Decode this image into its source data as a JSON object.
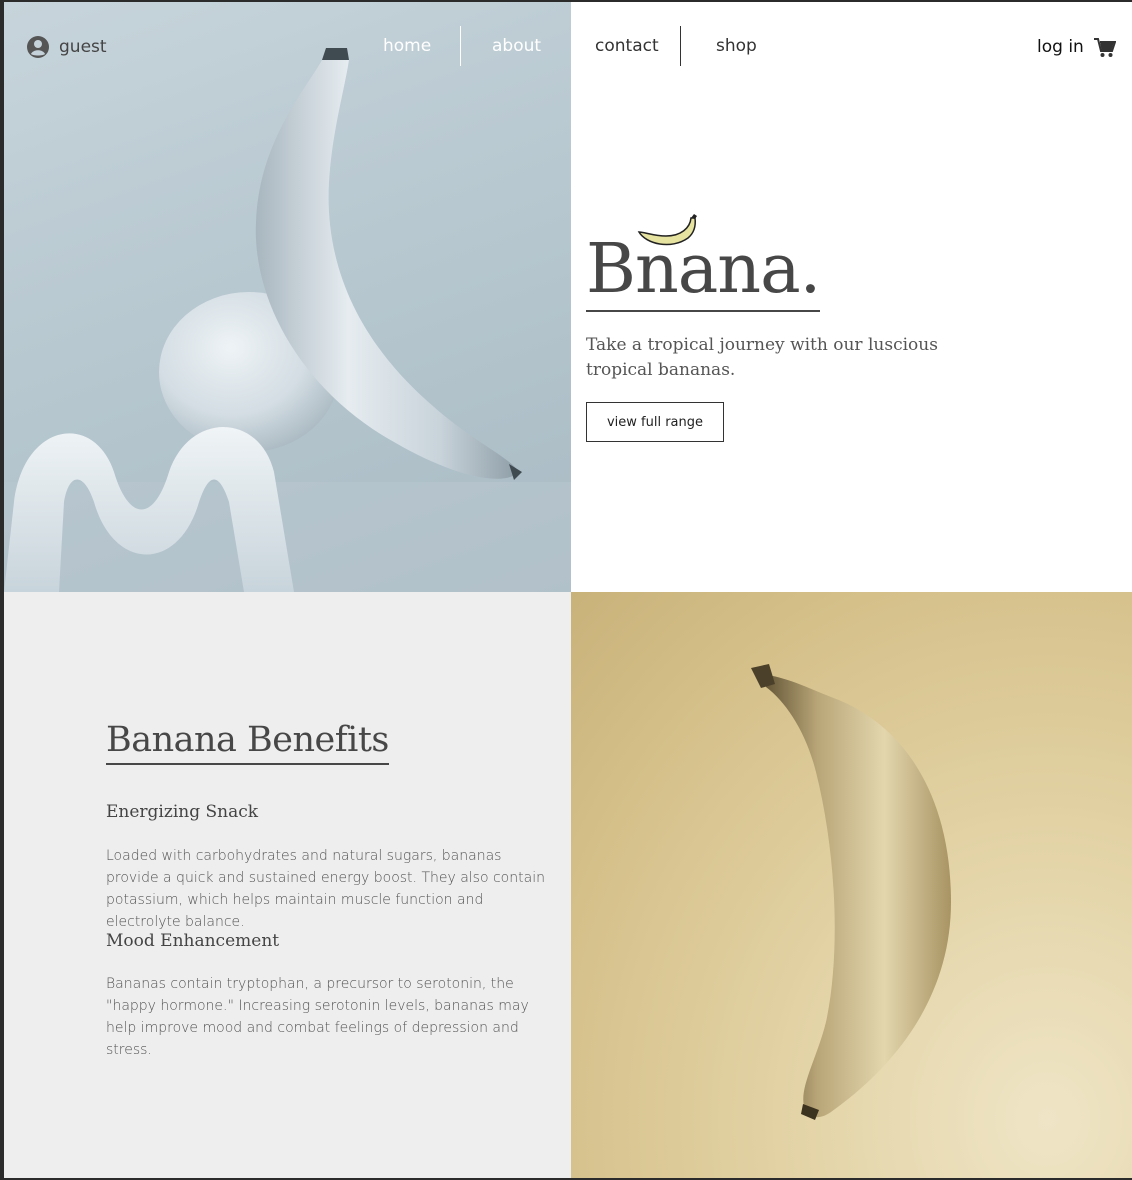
{
  "nav": {
    "user_label": "guest",
    "links": [
      {
        "label": "home",
        "color": "#ffffff"
      },
      {
        "label": "about",
        "color": "#ffffff"
      },
      {
        "label": "contact",
        "color": "#333333"
      },
      {
        "label": "shop",
        "color": "#333333"
      }
    ],
    "login_label": "log in"
  },
  "hero": {
    "brand": "Bnana.",
    "tagline": "Take a tropical journey with our luscious tropical bananas.",
    "cta_label": "view full range"
  },
  "benefits": {
    "title": "Banana Benefits",
    "items": [
      {
        "heading": "Energizing Snack",
        "body": "Loaded with carbohydrates and natural sugars, bananas provide a quick and sustained energy boost. They also contain potassium, which helps maintain muscle function and electrolyte balance."
      },
      {
        "heading": "Mood Enhancement",
        "body": "Bananas contain tryptophan, a precursor to serotonin, the \"happy hormone.\" Increasing serotonin levels, bananas may help improve mood and combat feelings of depression and stress."
      }
    ]
  },
  "icons": {
    "user": "user-circle-icon",
    "cart": "cart-icon",
    "logo": "banana-logo-icon"
  },
  "colors": {
    "text_dark": "#474747",
    "section_bg": "#eeeeee",
    "logo_fill": "#e6e3a0"
  }
}
